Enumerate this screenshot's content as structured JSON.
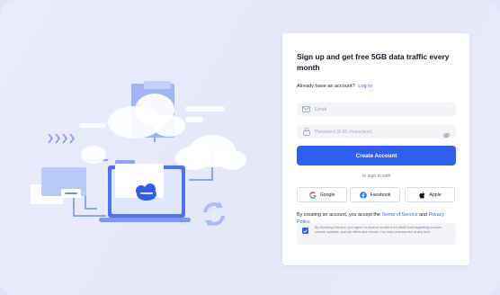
{
  "signup": {
    "title": "Sign up and get free 5GB data traffic every month",
    "already_text": "Already have an account?",
    "login_link": "Log In",
    "email_placeholder": "Email",
    "password_placeholder": "Password (8-30 characters)",
    "create_button": "Create Account",
    "or_sign_in": "or sign in with",
    "social": [
      {
        "label": "Google",
        "icon": "google-icon"
      },
      {
        "label": "Facebook",
        "icon": "facebook-icon"
      },
      {
        "label": "Apple",
        "icon": "apple-icon"
      }
    ],
    "terms_prefix": "By creating an account, you accept the",
    "terms_link": "Terms of Service",
    "terms_and": "and",
    "privacy_link": "Privacy Policy.",
    "consent_checked": true,
    "consent_text": "By checking this box, you agree to receive emails from MultCloud regarding product, service updates, special offers and events. You may unsubscribe at any time."
  },
  "colors": {
    "accent": "#2f5ef0",
    "background": "#e4e8f9",
    "field_bg": "#f3f4f8"
  }
}
